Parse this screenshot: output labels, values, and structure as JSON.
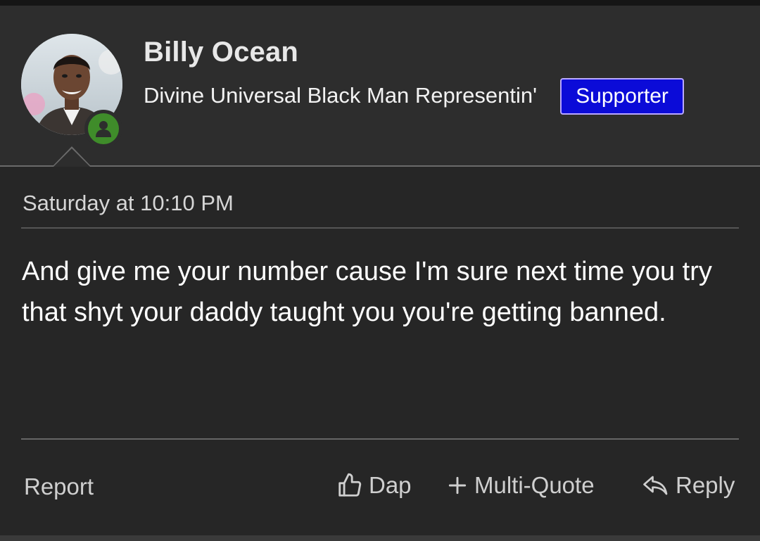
{
  "user": {
    "name": "Billy Ocean",
    "title": "Divine Universal Black Man Representin'",
    "badge": "Supporter",
    "online": true
  },
  "post": {
    "timestamp": "Saturday at 10:10 PM",
    "message": "And give me your number cause I'm sure next time you try that shyt your daddy taught you you're getting banned."
  },
  "actions": {
    "report": "Report",
    "dap": "Dap",
    "multi_quote": "Multi-Quote",
    "reply": "Reply"
  },
  "colors": {
    "badge_bg": "#0b0bd8",
    "badge_border": "#b9a8ff",
    "online": "#3f8c2a"
  }
}
